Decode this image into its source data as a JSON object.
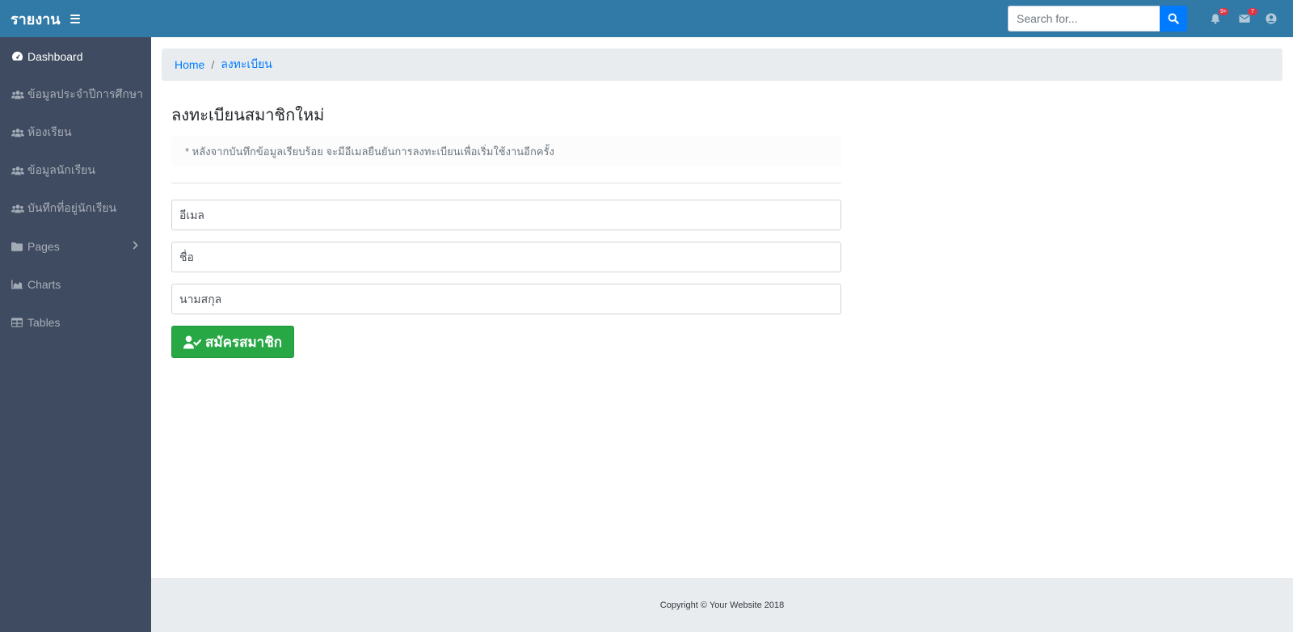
{
  "navbar": {
    "brand": "รายงาน",
    "search_placeholder": "Search for...",
    "notifications_count": "9+",
    "messages_count": "7"
  },
  "sidebar": {
    "items": [
      {
        "label": "Dashboard",
        "icon": "dashboard-icon",
        "active": true
      },
      {
        "label": "ข้อมูลประจำปีการศึกษา",
        "icon": "users-icon"
      },
      {
        "label": "ห้องเรียน",
        "icon": "users-icon"
      },
      {
        "label": "ข้อมูลนักเรียน",
        "icon": "users-icon"
      },
      {
        "label": "บันทึกที่อยู่นักเรียน",
        "icon": "users-icon"
      },
      {
        "label": "Pages",
        "icon": "folder-icon",
        "has_submenu": true
      },
      {
        "label": "Charts",
        "icon": "area-chart-icon"
      },
      {
        "label": "Tables",
        "icon": "table-icon"
      }
    ]
  },
  "breadcrumb": {
    "home": "Home",
    "current": "ลงทะเบียน"
  },
  "form": {
    "title": "ลงทะเบียนสมาชิกใหม่",
    "note": "* หลังจากบันทึกข้อมูลเรียบร้อย จะมีอีเมลยืนยันการลงทะเบียนเพื่อเริ่มใช้งานอีกครั้ง",
    "email_placeholder": "อีเมล",
    "firstname_placeholder": "ชื่อ",
    "lastname_placeholder": "นามสกุล",
    "submit_label": "สมัครสมาชิก"
  },
  "footer": {
    "copyright": "Copyright © Your Website 2018"
  },
  "colors": {
    "navbar": "#317aa8",
    "sidebar": "#3e4b60",
    "primary": "#007bff",
    "success": "#28a745",
    "badge": "#dc3545"
  }
}
